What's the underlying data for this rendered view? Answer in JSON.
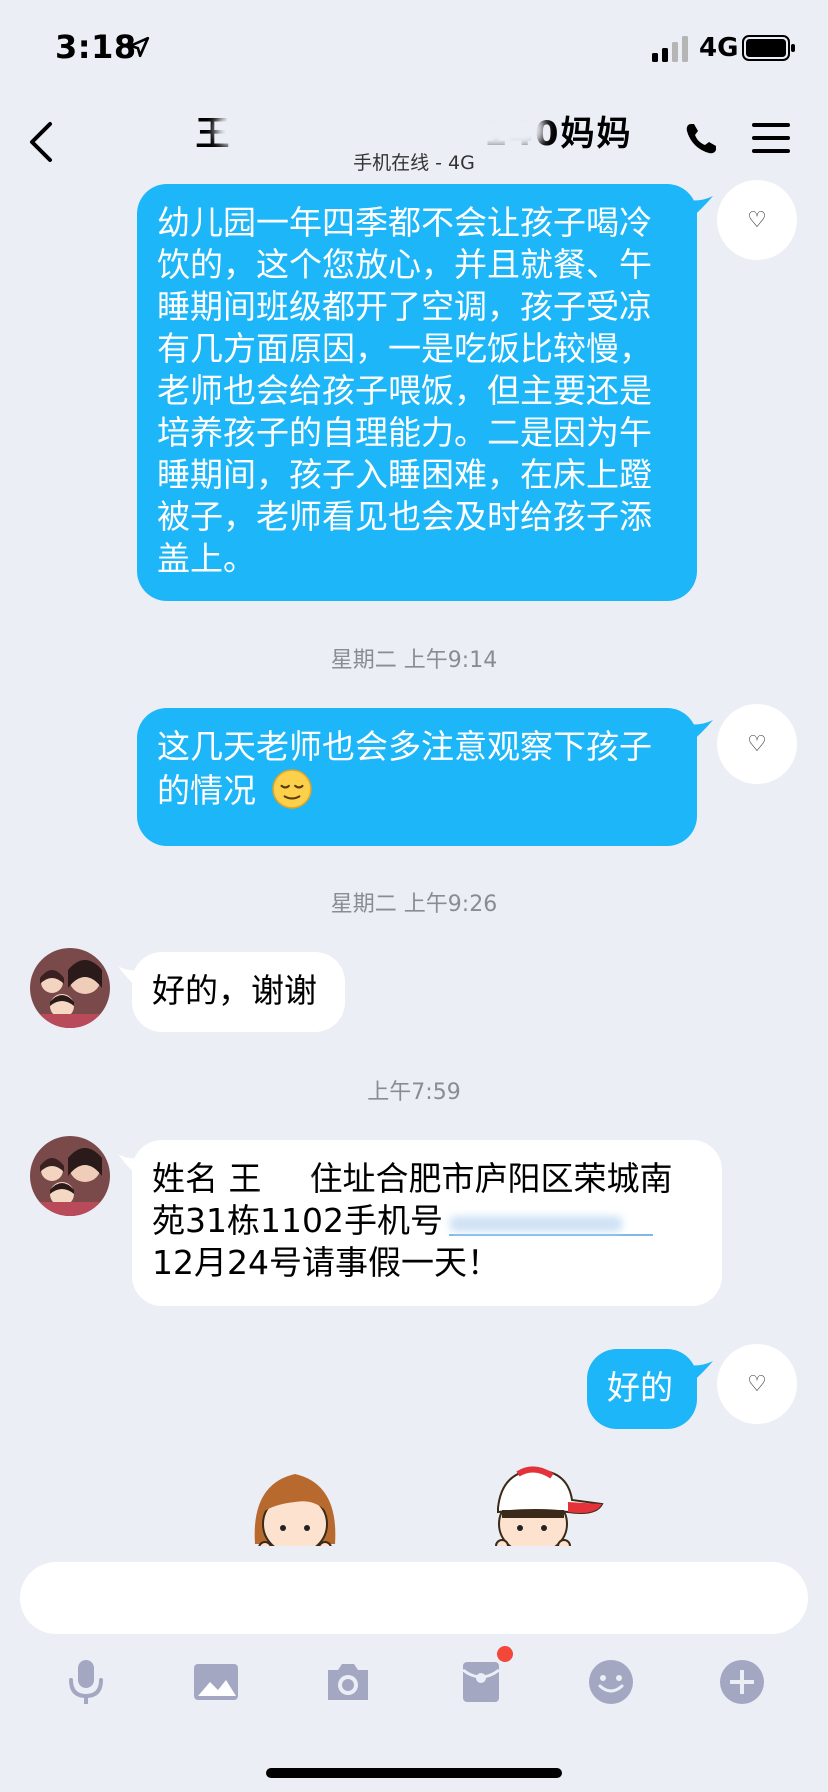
{
  "status_bar": {
    "time": "3:18",
    "network": "4G"
  },
  "header": {
    "title": "王　　　　　　　140妈妈",
    "subtitle": "手机在线 - 4G"
  },
  "messages": {
    "m1": "幼儿园一年四季都不会让孩子喝冷饮的，这个您放心，并且就餐、午睡期间班级都开了空调，孩子受凉有几方面原因，一是吃饭比较慢，老师也会给孩子喂饭，但主要还是培养孩子的自理能力。二是因为午睡期间，孩子入睡困难，在床上蹬被子，老师看见也会及时给孩子添盖上。",
    "t1": "星期二 上午9:14",
    "m2": "这几天老师也会多注意观察下孩子的情况",
    "t2": "星期二 上午9:26",
    "m3": "好的，谢谢",
    "t3": "上午7:59",
    "m4_a": "姓名 王",
    "m4_b": "住址合肥市庐阳区荣城南苑31栋1102手机号",
    "m4_c": "12月24号请事假一天！",
    "m5": "好的"
  },
  "heart_icon": "♡",
  "colors": {
    "outgoing": "#1db6f8",
    "background": "#eceef6",
    "badge": "#f3473a",
    "icons": "#a3a7c2"
  }
}
